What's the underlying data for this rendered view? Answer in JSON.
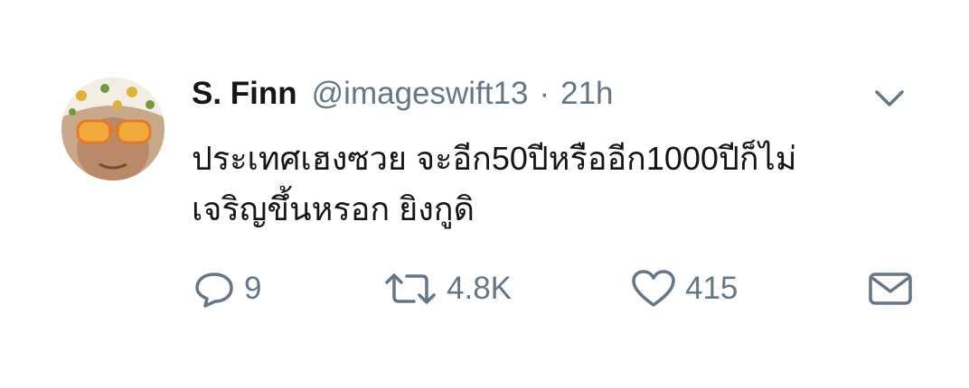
{
  "tweet": {
    "display_name": "S. Finn",
    "handle": "@imageswift13",
    "separator": "·",
    "time": "21h",
    "text_lines": [
      "ประเทศเฮงซวย จะอีก50ปีหรืออีก1000ปีก็ไม่",
      "เจริญขึ้นหรอก ยิงกูดิ"
    ],
    "avatar_icon": "avatar-photo",
    "menu_icon": "chevron-down-icon"
  },
  "actions": {
    "reply": {
      "icon": "reply-icon",
      "count": "9"
    },
    "retweet": {
      "icon": "retweet-icon",
      "count": "4.8K"
    },
    "like": {
      "icon": "heart-icon",
      "count": "415"
    },
    "message": {
      "icon": "envelope-icon"
    }
  },
  "colors": {
    "primary_text": "#14171a",
    "secondary_text": "#657786",
    "background": "#ffffff"
  }
}
